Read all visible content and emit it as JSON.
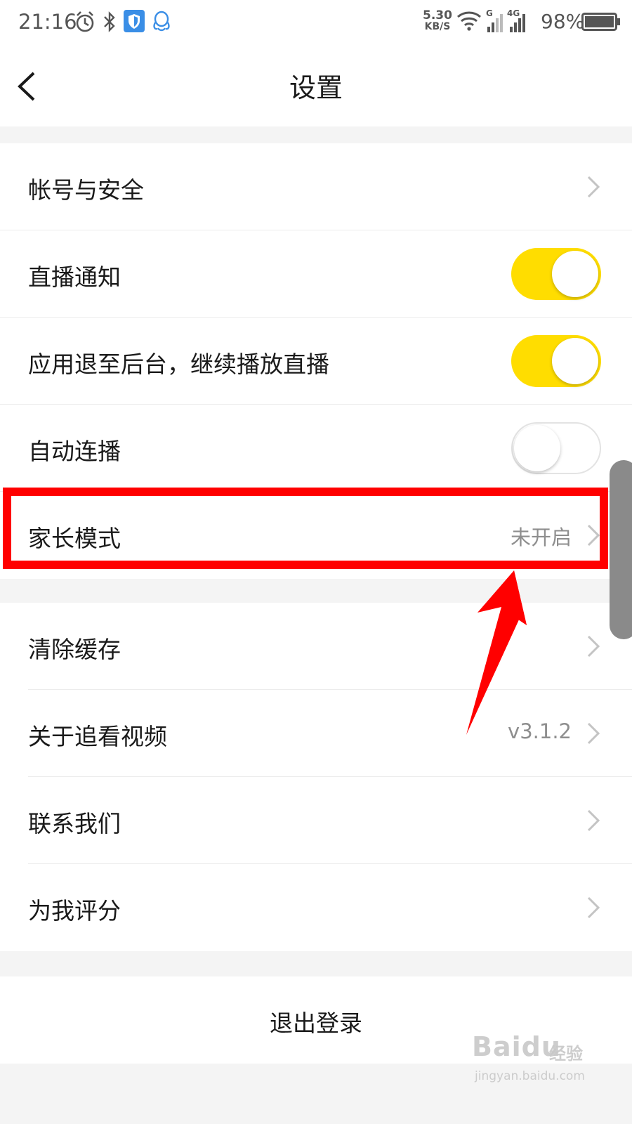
{
  "status_bar": {
    "time": "21:16",
    "network_speed_value": "5.30",
    "network_speed_unit": "KB/S",
    "network_labels": [
      "G",
      "4G"
    ],
    "battery_percent": "98%",
    "icons": [
      "alarm-icon",
      "bluetooth-icon",
      "shield-app-icon",
      "qq-icon",
      "wifi-icon",
      "signal-icon",
      "battery-icon"
    ]
  },
  "header": {
    "title": "设置",
    "back_icon": "back-arrow-icon"
  },
  "group1": {
    "items": [
      {
        "label": "帐号与安全",
        "type": "link"
      },
      {
        "label": "直播通知",
        "type": "toggle",
        "state": "on"
      },
      {
        "label": "应用退至后台，继续播放直播",
        "type": "toggle",
        "state": "on"
      },
      {
        "label": "自动连播",
        "type": "toggle",
        "state": "off"
      },
      {
        "label": "家长模式",
        "type": "link",
        "value": "未开启"
      }
    ]
  },
  "group2": {
    "items": [
      {
        "label": "清除缓存",
        "type": "link"
      },
      {
        "label": "关于追看视频",
        "type": "link",
        "value": "v3.1.2"
      },
      {
        "label": "联系我们",
        "type": "link"
      },
      {
        "label": "为我评分",
        "type": "link"
      }
    ]
  },
  "logout": {
    "label": "退出登录"
  },
  "colors": {
    "toggle_on": "#ffdd00",
    "annotation": "#ff0000",
    "page_bg": "#f4f4f4"
  },
  "watermark": {
    "brand": "Baidu",
    "sub": "经验",
    "url": "jingyan.baidu.com"
  }
}
